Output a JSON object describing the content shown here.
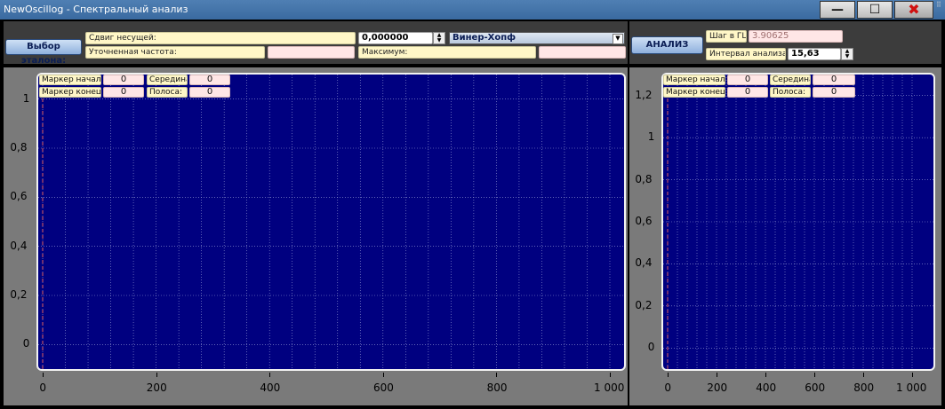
{
  "window": {
    "title": "NewOscillog - Спектральный анализ",
    "minimize": "—",
    "maximize": "☐",
    "close": "✖"
  },
  "toolbar_left": {
    "select_button": "Выбор эталона:",
    "carrier_shift_label": "Сдвиг несущей:",
    "carrier_shift_value": "0,000000",
    "refined_freq_label": "Уточненная частота:",
    "refined_freq_value": "",
    "method_selected": "Винер-Хопф",
    "maximum_label": "Максимум:",
    "maximum_value": ""
  },
  "toolbar_right": {
    "analysis_button": "АНАЛИЗ",
    "step_label": "Шаг в ГЦ:",
    "step_value": "3.90625",
    "interval_label": "Интервал анализа:",
    "interval_value": "15,63"
  },
  "left_chart": {
    "markers": {
      "start_label": "Маркер начало:",
      "start_value": "0",
      "middle_label": "Середина:",
      "middle_value": "0",
      "end_label": "Маркер конец:",
      "end_value": "0",
      "band_label": "Полоса:",
      "band_value": "0"
    }
  },
  "right_chart": {
    "markers": {
      "start_label": "Маркер начало:",
      "start_value": "0",
      "middle_label": "Середина:",
      "middle_value": "0",
      "end_label": "Маркер конец:",
      "end_value": "0",
      "band_label": "Полоса:",
      "band_value": "0"
    }
  },
  "chart_data": [
    {
      "type": "line",
      "series": [],
      "xlim": [
        0,
        1000
      ],
      "ylim": [
        -0.1,
        1.1
      ],
      "x_ticks": [
        "0",
        "200",
        "400",
        "600",
        "800",
        "1 000"
      ],
      "y_ticks": [
        "1",
        "0,8",
        "0,6",
        "0,4",
        "0,2",
        "0"
      ],
      "grid": true,
      "background": "#000080"
    },
    {
      "type": "line",
      "series": [],
      "xlim": [
        0,
        1000
      ],
      "ylim": [
        -0.1,
        1.3
      ],
      "x_ticks": [
        "0",
        "200",
        "400",
        "600",
        "800",
        "1 000"
      ],
      "y_ticks": [
        "1,2",
        "1",
        "0,8",
        "0,6",
        "0,4",
        "0,2",
        "0"
      ],
      "grid": true,
      "background": "#000080"
    }
  ]
}
